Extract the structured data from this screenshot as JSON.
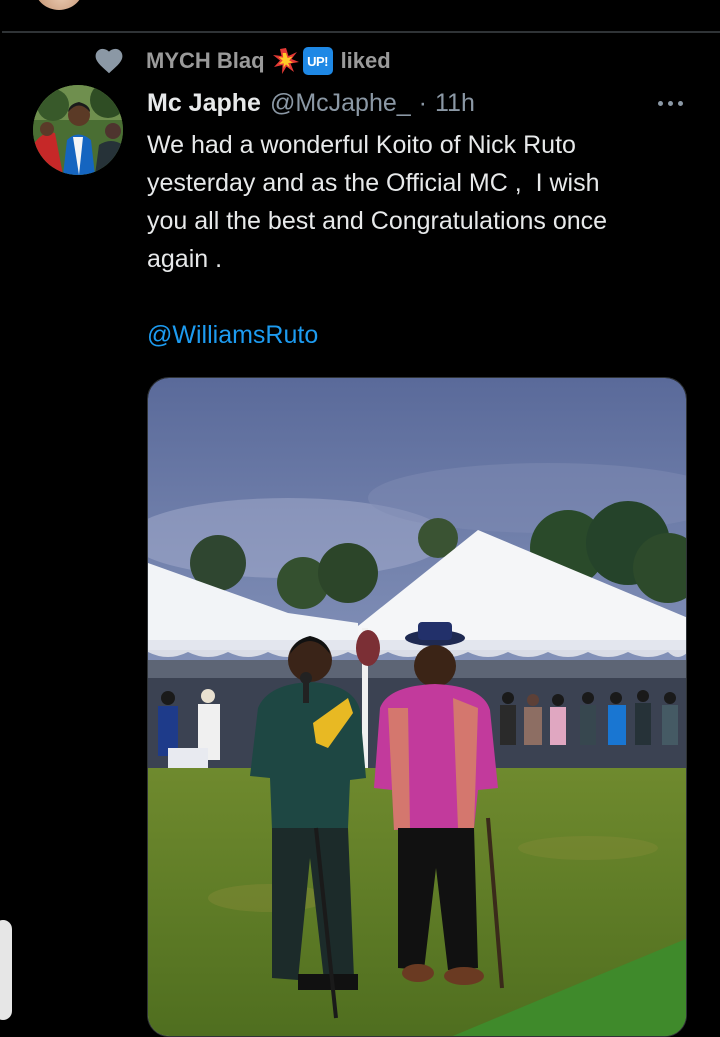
{
  "social_context": {
    "name": "MYCH Blaq",
    "badge_label": "UP!",
    "action": "liked"
  },
  "tweet": {
    "display_name": "Mc Japhe",
    "handle": "@McJaphe_",
    "separator": "·",
    "time": "11h",
    "text": "We had a wonderful Koito of Nick Ruto\nyesterday and as the Official MC ,  I wish\nyou all the best and Congratulations once\nagain .",
    "mention": "@WilliamsRuto"
  },
  "icons": {
    "heart": "heart-icon",
    "boom": "collision-emoji-icon",
    "badge": "up-button-emoji-icon",
    "more": "more-options-icon"
  },
  "colors": {
    "background": "#000000",
    "text": "#e7e9ea",
    "secondary_text": "#8b98a5",
    "link": "#1d9bf0",
    "divider": "#2f3336"
  }
}
